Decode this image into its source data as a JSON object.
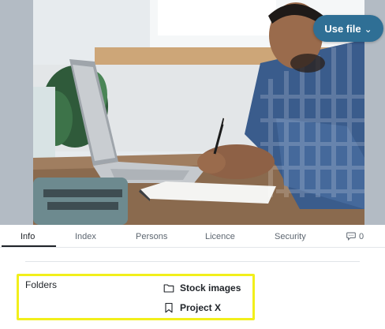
{
  "preview": {
    "image_alt": "Man writing in a notebook next to a laptop",
    "use_file_label": "Use file",
    "use_file_icon": "chevron-down-icon"
  },
  "tabs": [
    {
      "label": "Info",
      "active": true
    },
    {
      "label": "Index",
      "active": false
    },
    {
      "label": "Persons",
      "active": false
    },
    {
      "label": "Licence",
      "active": false
    },
    {
      "label": "Security",
      "active": false
    },
    {
      "label": "0",
      "icon": "comment-icon",
      "active": false
    }
  ],
  "info": {
    "folders_label": "Folders",
    "folders": [
      {
        "name": "Stock images",
        "icon": "folder-icon"
      },
      {
        "name": "Project X",
        "icon": "bookmark-icon"
      }
    ]
  },
  "colors": {
    "accent_button": "#2f6f95",
    "highlight": "#f2ef1b"
  }
}
